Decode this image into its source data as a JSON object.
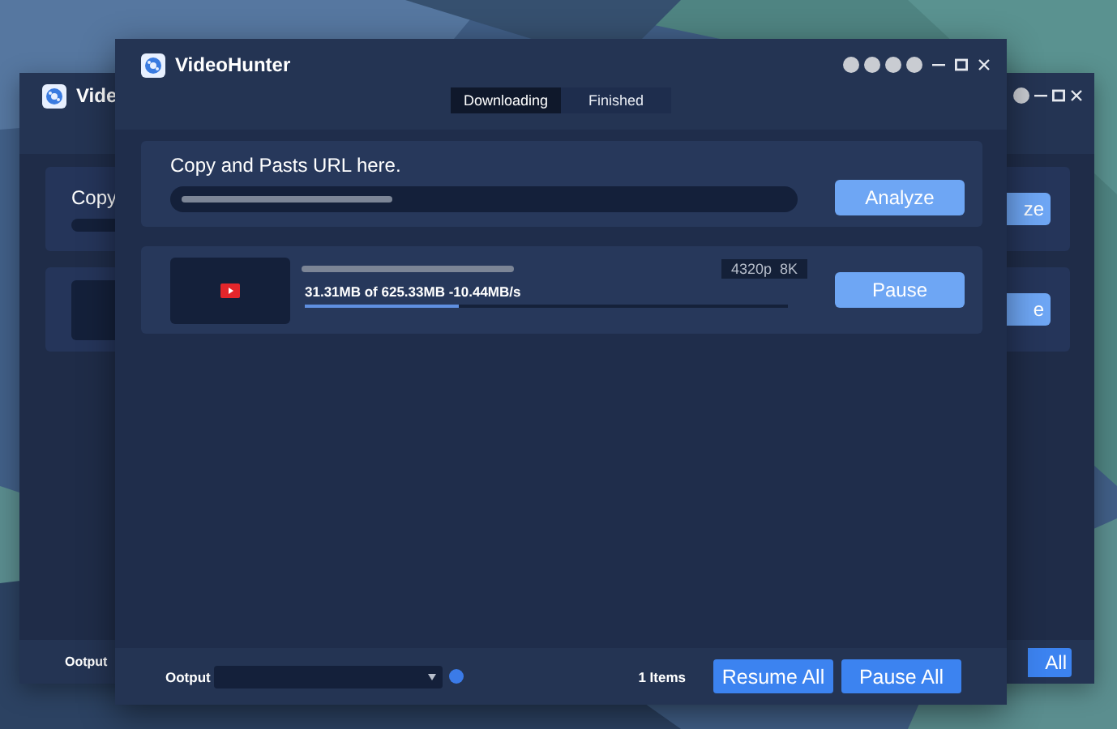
{
  "back_window": {
    "title": "Vide",
    "url_label": "Copy",
    "analyze_button": "ze",
    "pause_button": "e",
    "output_label": "Ootput",
    "pause_all_button": "All"
  },
  "window": {
    "title": "VideoHunter"
  },
  "tabs": [
    {
      "label": "Downloading",
      "selected": true
    },
    {
      "label": "Finished",
      "selected": false
    }
  ],
  "url_input": {
    "label": "Copy and Pasts URL here.",
    "button": "Analyze"
  },
  "downloads": [
    {
      "quality": "4320p  8K",
      "progress_text": "31.31MB of 625.33MB -10.44MB/s",
      "level": 0.32,
      "button": "Pause"
    }
  ],
  "footer": {
    "output_label": "Ootput",
    "item_count": "1 Items",
    "buttons": [
      "Resume All",
      "Pause All"
    ]
  }
}
